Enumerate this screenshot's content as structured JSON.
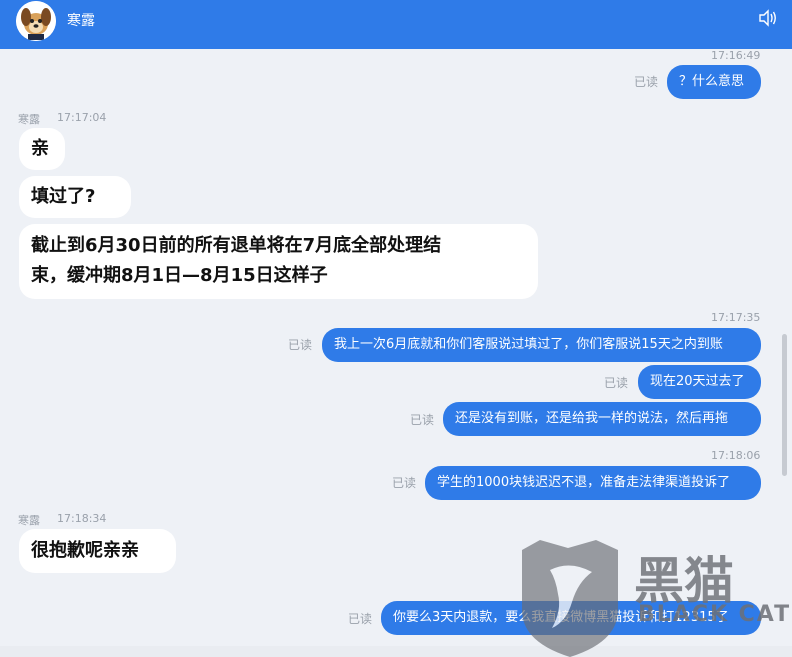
{
  "header": {
    "title": "寒露",
    "accent": "#2f7be8"
  },
  "messages": [
    {
      "type": "time",
      "text": "17:16:49"
    },
    {
      "type": "out",
      "text": "？什么意思",
      "status": "已读"
    },
    {
      "type": "sender",
      "name": "寒露",
      "time": "17:17:04"
    },
    {
      "type": "in",
      "text": "亲"
    },
    {
      "type": "in",
      "text": "填过了?"
    },
    {
      "type": "in",
      "lines": [
        "截止到6月30日前的所有退单将在7月底全部处理结",
        "束，缓冲期8月1日—8月15日这样子"
      ]
    },
    {
      "type": "time",
      "text": "17:17:35"
    },
    {
      "type": "out",
      "text": "我上一次6月底就和你们客服说过填过了，你们客服说15天之内到账",
      "status": "已读"
    },
    {
      "type": "out",
      "text": "现在20天过去了",
      "status": "已读"
    },
    {
      "type": "out",
      "text": "还是没有到账，还是给我一样的说法，然后再拖",
      "status": "已读"
    },
    {
      "type": "time",
      "text": "17:18:06"
    },
    {
      "type": "out",
      "text": "学生的1000块钱迟迟不退，准备走法律渠道投诉了",
      "status": "已读"
    },
    {
      "type": "sender",
      "name": "寒露",
      "time": "17:18:34"
    },
    {
      "type": "in",
      "text": "很抱歉呢亲亲"
    },
    {
      "type": "out",
      "text": "你要么3天内退款，要么我直接微博黑猫投诉和打12315了",
      "status": "已读"
    }
  ],
  "watermark": {
    "cn": "黑猫",
    "en": "BLACK CAT"
  }
}
